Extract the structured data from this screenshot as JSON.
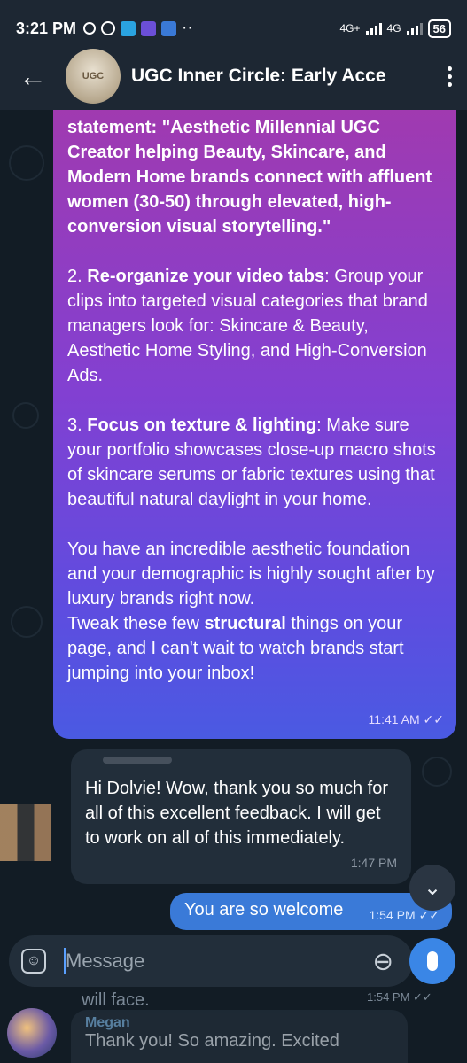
{
  "status_bar": {
    "time": "3:21 PM",
    "network_1": "4G+",
    "network_2": "4G",
    "battery": "56"
  },
  "header": {
    "title": "UGC Inner Circle: Early Acce",
    "avatar_text": "UGC"
  },
  "messages": {
    "outgoing_long": {
      "p1": "statement: \"Aesthetic Millennial UGC Creator helping Beauty, Skincare, and Modern Home brands connect with affluent women (30-50) through elevated, high-conversion visual storytelling.\"",
      "p2_num": "2. ",
      "p2_bold": "Re-organize your video tabs",
      "p2_rest": ": Group your clips into targeted visual categories that brand managers look for: Skincare & Beauty, Aesthetic Home Styling, and High-Conversion Ads.",
      "p3_num": "3. ",
      "p3_bold": "Focus on texture & lighting",
      "p3_rest": ": Make sure your portfolio showcases close-up macro shots of skincare serums or fabric textures using that beautiful natural daylight in your home.",
      "p4": "You have an incredible aesthetic foundation and your demographic is highly sought after by luxury brands right now.",
      "p5_pre": "Tweak these few ",
      "p5_bold": "structural",
      "p5_rest": " things on your page, and I can't wait to watch brands start jumping into your inbox!",
      "time": "11:41 AM ✓✓"
    },
    "incoming_reply": {
      "text": "Hi Dolvie! Wow, thank you so much for all of this excellent feedback. I will get to work on all of this immediately.",
      "time": "1:47 PM"
    },
    "outgoing_short": {
      "text": "You are so welcome",
      "time": "1:54 PM ✓✓"
    },
    "partial_below": {
      "text": "will face.",
      "time": "1:54 PM ✓✓"
    },
    "megan": {
      "name": "Megan",
      "text": "Thank you! So amazing. Excited"
    }
  },
  "composer": {
    "placeholder": "Message"
  },
  "icons": {
    "back": "arrow-left",
    "menu": "vertical-dots",
    "emoji": "sticker",
    "attach": "paperclip",
    "mic": "microphone",
    "scroll": "chevron-down"
  }
}
